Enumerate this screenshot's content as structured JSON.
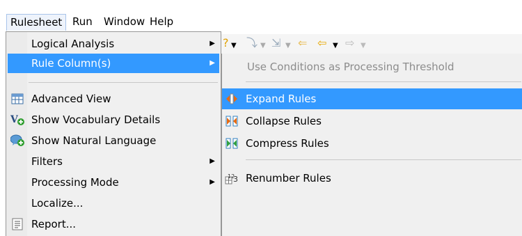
{
  "menubar": {
    "items": [
      {
        "label": "Rulesheet"
      },
      {
        "label": "Run"
      },
      {
        "label": "Window"
      },
      {
        "label": "Help"
      }
    ]
  },
  "main_menu": {
    "items": [
      {
        "label": "Logical Analysis",
        "submenu": true
      },
      {
        "label": "Rule Column(s)",
        "submenu": true,
        "selected": true
      },
      {
        "label": "Advanced View",
        "icon": "table-view-icon"
      },
      {
        "label": "Show Vocabulary Details",
        "icon": "vocabulary-add-icon"
      },
      {
        "label": "Show Natural Language",
        "icon": "speech-bubble-add-icon"
      },
      {
        "label": "Filters",
        "submenu": true
      },
      {
        "label": "Processing Mode",
        "submenu": true
      },
      {
        "label": "Localize..."
      },
      {
        "label": "Report...",
        "icon": "report-icon"
      }
    ]
  },
  "submenu": {
    "items": [
      {
        "label": "Use Conditions as Processing Threshold",
        "disabled": true
      },
      {
        "label": "Expand Rules",
        "icon": "expand-rules-icon",
        "selected": true
      },
      {
        "label": "Collapse Rules",
        "icon": "collapse-rules-icon"
      },
      {
        "label": "Compress Rules",
        "icon": "compress-rules-icon"
      },
      {
        "label": "Renumber Rules",
        "icon": "renumber-rules-icon"
      }
    ]
  },
  "colors": {
    "selection": "#3399ff",
    "menu_bg": "#f0f0f0",
    "disabled_text": "#8c8c8c"
  }
}
